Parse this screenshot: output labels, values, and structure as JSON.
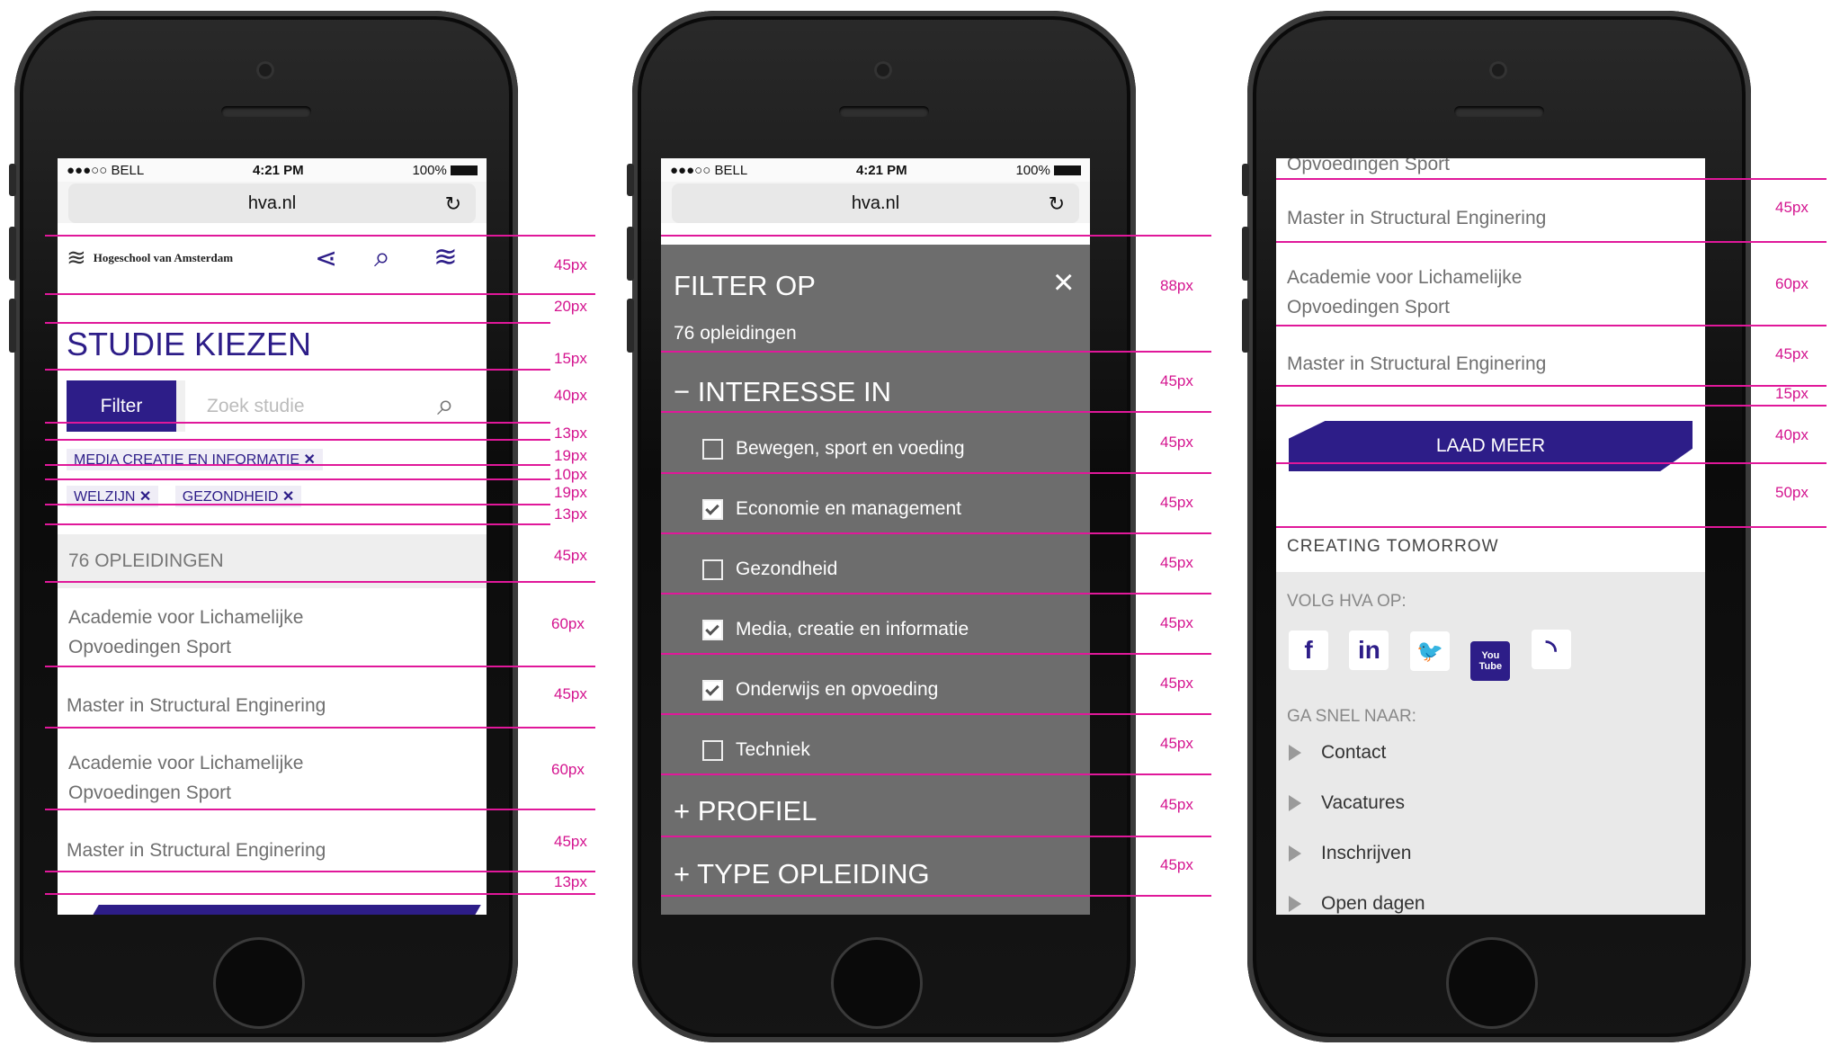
{
  "status": {
    "carrier": "●●●○○ BELL",
    "time": "4:21 PM",
    "battery": "100%"
  },
  "url": "hva.nl",
  "colors": {
    "accent": "#2d1d88",
    "measure": "#e0189a",
    "overlay": "#6d6d6d"
  },
  "phone1": {
    "logo_text": "Hogeschool van Amsterdam",
    "title": "STUDIE KIEZEN",
    "filter_button": "Filter",
    "search_placeholder": "Zoek studie",
    "tags": [
      "MEDIA CREATIE EN INFORMATIE",
      "WELZIJN",
      "GEZONDHEID"
    ],
    "count": "76 OPLEIDINGEN",
    "items": [
      {
        "line1": "Academie voor Lichamelijke",
        "line2": "Opvoedingen Sport"
      },
      {
        "line1": "Master in Structural Enginering",
        "line2": ""
      },
      {
        "line1": "Academie voor Lichamelijke",
        "line2": "Opvoedingen Sport"
      },
      {
        "line1": "Master in Structural Enginering",
        "line2": ""
      }
    ],
    "measures": [
      "45px",
      "20px",
      "15px",
      "40px",
      "13px",
      "19px",
      "10px",
      "19px",
      "13px",
      "45px",
      "60px",
      "45px",
      "60px",
      "45px",
      "13px"
    ]
  },
  "phone2": {
    "title": "FILTER OP",
    "subtitle": "76 opleidingen",
    "close": "×",
    "section_open": "INTERESSE IN",
    "options": [
      {
        "label": "Bewegen, sport en voeding",
        "checked": false
      },
      {
        "label": "Economie en management",
        "checked": true
      },
      {
        "label": "Gezondheid",
        "checked": false
      },
      {
        "label": "Media, creatie en informatie",
        "checked": true
      },
      {
        "label": "Onderwijs en opvoeding",
        "checked": true
      },
      {
        "label": "Techniek",
        "checked": false
      }
    ],
    "collapsed": [
      "PROFIEL",
      "TYPE OPLEIDING"
    ],
    "measures": [
      "88px",
      "45px",
      "45px",
      "45px",
      "45px",
      "45px",
      "45px",
      "45px",
      "45px",
      "45px"
    ]
  },
  "phone3": {
    "top_text": "Opvoedingen Sport",
    "items": [
      {
        "line1": "Master in Structural Enginering",
        "line2": ""
      },
      {
        "line1": "Academie voor Lichamelijke",
        "line2": "Opvoedingen Sport"
      },
      {
        "line1": "Master in Structural Enginering",
        "line2": ""
      }
    ],
    "load_more": "LAAD MEER",
    "footer_title": "CREATING TOMORROW",
    "follow_label": "VOLG HVA OP:",
    "social_icons": [
      "facebook-icon",
      "linkedin-icon",
      "twitter-icon",
      "youtube-icon",
      "rss-icon"
    ],
    "social_glyphs": [
      "f",
      "in",
      "🐦",
      "You Tube",
      "◝"
    ],
    "goto_label": "GA SNEL NAAR:",
    "links": [
      "Contact",
      "Vacatures",
      "Inschrijven",
      "Open dagen"
    ],
    "measures": [
      "45px",
      "60px",
      "45px",
      "15px",
      "40px",
      "50px"
    ]
  }
}
